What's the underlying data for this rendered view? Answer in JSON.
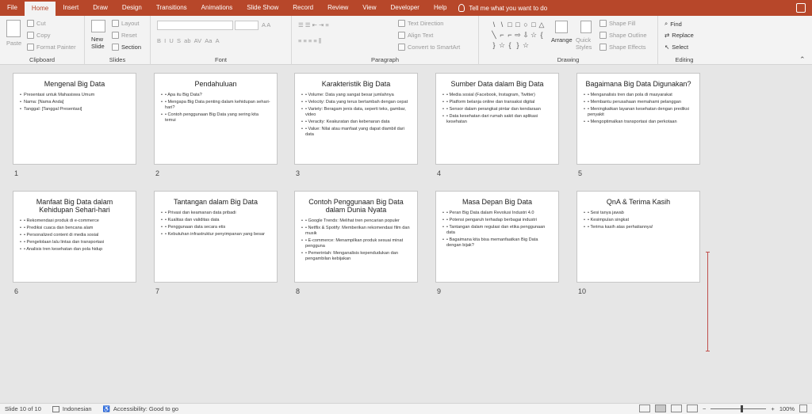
{
  "menu": {
    "tabs": [
      "File",
      "Home",
      "Insert",
      "Draw",
      "Design",
      "Transitions",
      "Animations",
      "Slide Show",
      "Record",
      "Review",
      "View",
      "Developer",
      "Help"
    ],
    "active": "Home",
    "tell_me": "Tell me what you want to do"
  },
  "ribbon": {
    "clipboard": {
      "label": "Clipboard",
      "paste": "Paste",
      "cut": "Cut",
      "copy": "Copy",
      "format_painter": "Format Painter"
    },
    "slides": {
      "label": "Slides",
      "new_slide": "New Slide",
      "layout": "Layout",
      "reset": "Reset",
      "section": "Section"
    },
    "font": {
      "label": "Font"
    },
    "paragraph": {
      "label": "Paragraph",
      "text_direction": "Text Direction",
      "align_text": "Align Text",
      "convert_smartart": "Convert to SmartArt"
    },
    "drawing": {
      "label": "Drawing",
      "arrange": "Arrange",
      "quick_styles": "Quick Styles",
      "shape_fill": "Shape Fill",
      "shape_outline": "Shape Outline",
      "shape_effects": "Shape Effects"
    },
    "editing": {
      "label": "Editing",
      "find": "Find",
      "replace": "Replace",
      "select": "Select"
    }
  },
  "slides": [
    {
      "num": "1",
      "title": "Mengenal Big Data",
      "bullets": [
        "Presentasi untuk Mahasiswa Umum",
        "Nama: [Nama Anda]",
        "Tanggal: [Tanggal Presentasi]"
      ]
    },
    {
      "num": "2",
      "title": "Pendahuluan",
      "bullets": [
        "• Apa itu Big Data?",
        "• Mengapa Big Data penting dalam kehidupan sehari-hari?",
        "• Contoh penggunaan Big Data yang sering kita temui"
      ]
    },
    {
      "num": "3",
      "title": "Karakteristik Big Data",
      "bullets": [
        "• Volume: Data yang sangat besar jumlahnya",
        "• Velocity: Data yang terus bertambah dengan cepat",
        "• Variety: Beragam jenis data, seperti teks, gambar, video",
        "• Veracity: Keakuratan dan kebenaran data",
        "• Value: Nilai atau manfaat yang dapat diambil dari data"
      ]
    },
    {
      "num": "4",
      "title": "Sumber Data dalam Big Data",
      "bullets": [
        "• Media sosial (Facebook, Instagram, Twitter)",
        "• Platform belanja online dan transaksi digital",
        "• Sensor dalam perangkat pintar dan kendaraan",
        "• Data kesehatan dari rumah sakit dan aplikasi kesehatan"
      ]
    },
    {
      "num": "5",
      "title": "Bagaimana Big Data Digunakan?",
      "bullets": [
        "• Menganalisis tren dan pola di masyarakat",
        "• Membantu perusahaan memahami pelanggan",
        "• Meningkatkan layanan kesehatan dengan prediksi penyakit",
        "• Mengoptimalkan transportasi dan perkotaan"
      ]
    },
    {
      "num": "6",
      "title": "Manfaat Big Data dalam Kehidupan Sehari-hari",
      "bullets": [
        "• Rekomendasi produk di e-commerce",
        "• Prediksi cuaca dan bencana alam",
        "• Personalized content di media sosial",
        "• Pengelolaan lalu lintas dan transportasi",
        "• Analisis tren kesehatan dan pola hidup"
      ]
    },
    {
      "num": "7",
      "title": "Tantangan dalam Big Data",
      "bullets": [
        "• Privasi dan keamanan data pribadi",
        "• Kualitas dan validitas data",
        "• Penggunaan data secara etis",
        "• Kebutuhan infrastruktur penyimpanan yang besar"
      ]
    },
    {
      "num": "8",
      "title": "Contoh Penggunaan Big Data dalam Dunia Nyata",
      "bullets": [
        "• Google Trends: Melihat tren pencarian populer",
        "• Netflix & Spotify: Memberikan rekomendasi film dan musik",
        "• E-commerce: Menampilkan produk sesuai minat pengguna",
        "• Pemerintah: Menganalisis kependudukan dan pengambilan kebijakan"
      ]
    },
    {
      "num": "9",
      "title": "Masa Depan Big Data",
      "bullets": [
        "• Peran Big Data dalam Revolusi Industri 4.0",
        "• Potensi pengaruh terhadap berbagai industri",
        "• Tantangan dalam regulasi dan etika penggunaan data",
        "• Bagaimana kita bisa memanfaatkan Big Data dengan bijak?"
      ]
    },
    {
      "num": "10",
      "title": "QnA & Terima Kasih",
      "bullets": [
        "• Sesi tanya jawab",
        "• Kesimpulan singkat",
        "• Terima kasih atas perhatiannya!"
      ]
    }
  ],
  "status": {
    "slide_info": "Slide 10 of 10",
    "language": "Indonesian",
    "accessibility": "Accessibility: Good to go",
    "zoom": "100%"
  }
}
